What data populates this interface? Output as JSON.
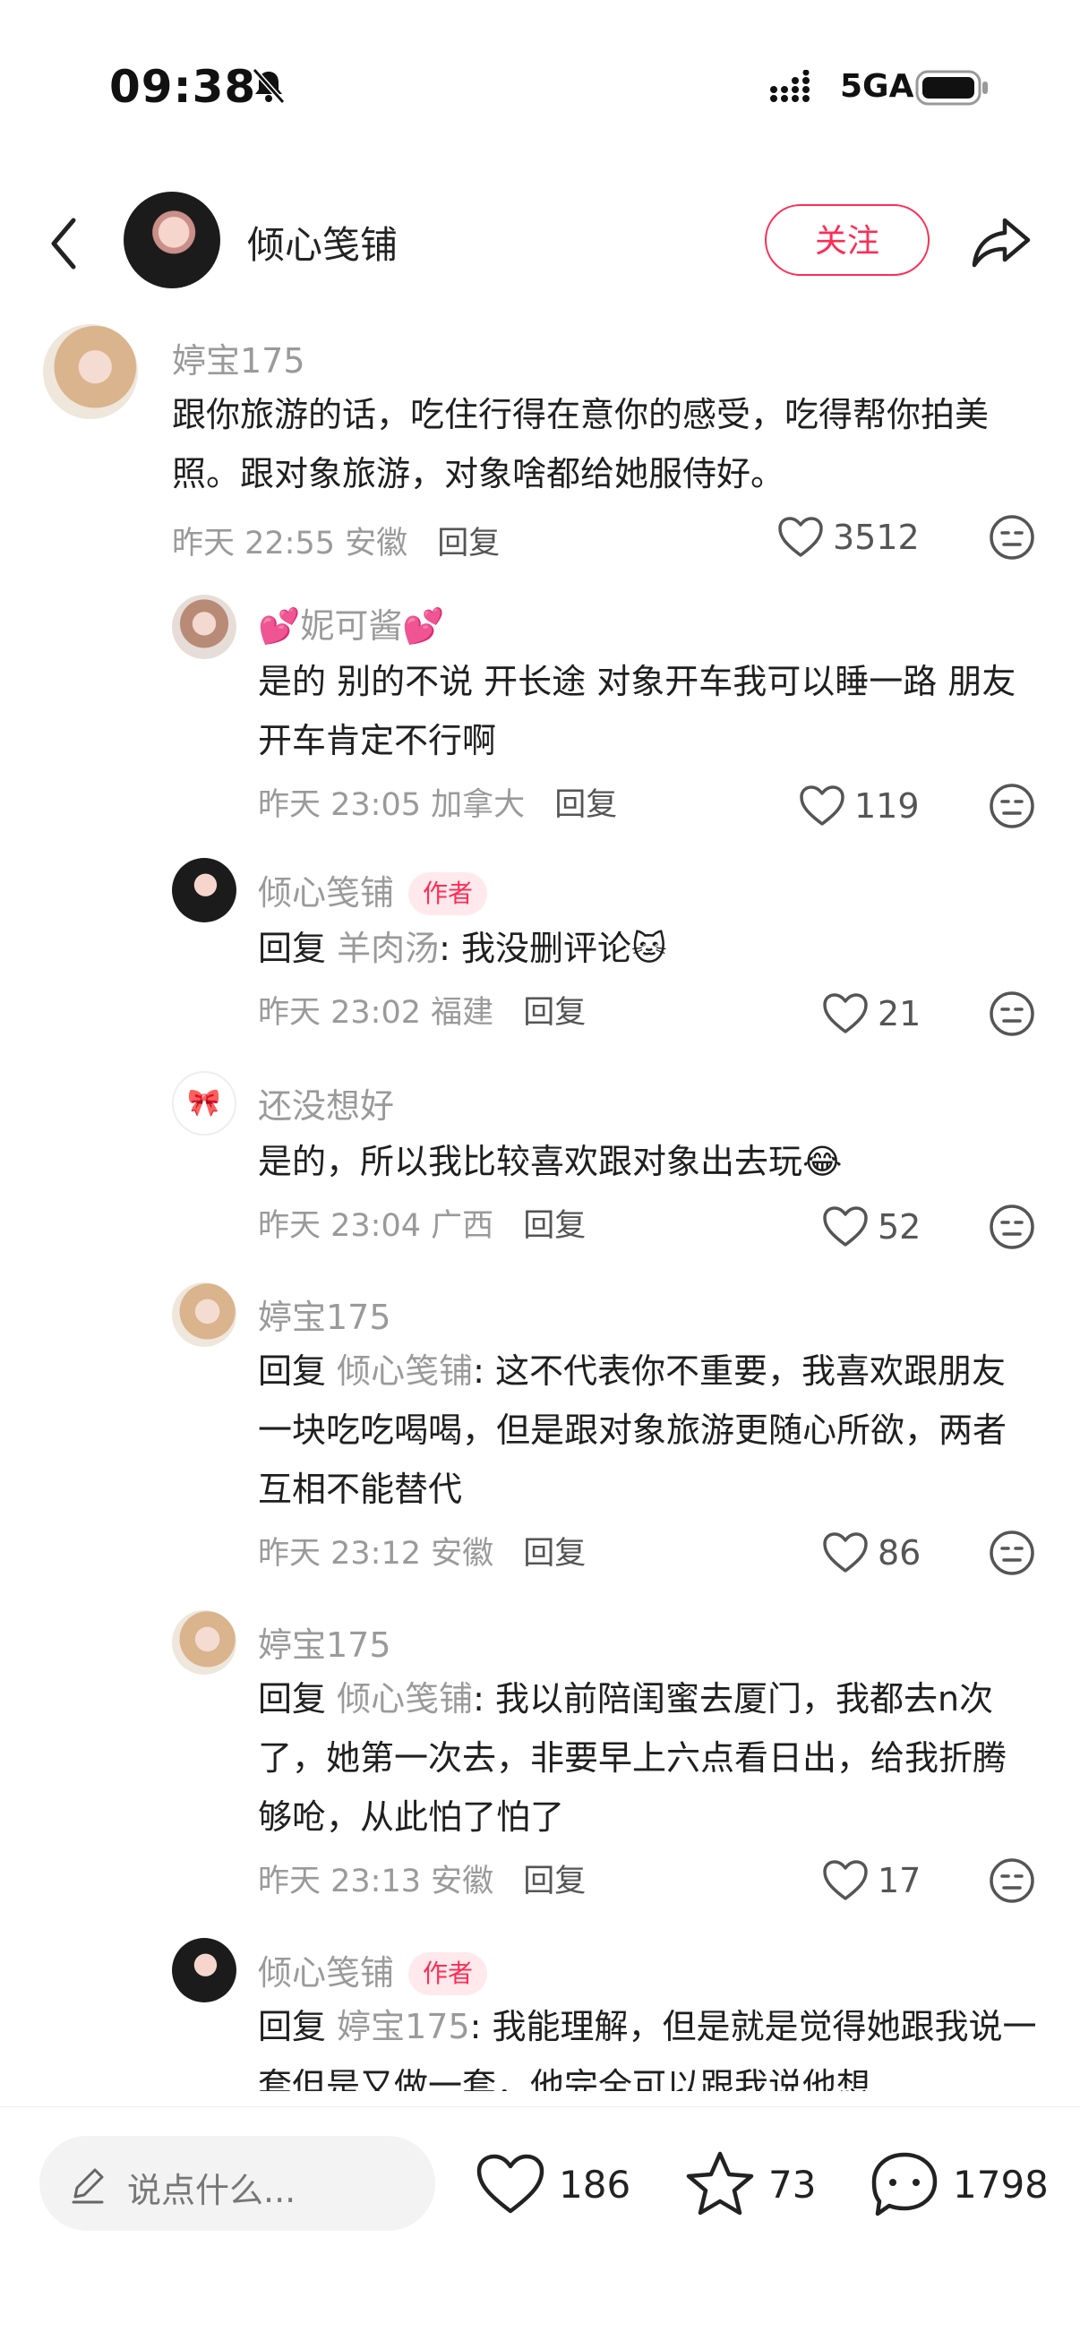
{
  "status_bar": {
    "time": "09:38",
    "network": "5GA"
  },
  "header": {
    "name": "倾心笺铺",
    "follow_label": "关注"
  },
  "comments": [
    {
      "name": "婷宝175",
      "text": "跟你旅游的话，吃住行得在意你的感受，吃得帮你拍美照。跟对象旅游，对象啥都给她服侍好。",
      "time": "昨天 22:55",
      "location": "安徽",
      "reply_label": "回复",
      "likes": "3512"
    },
    {
      "name": "妮可酱",
      "name_deco": "💕",
      "text": "是的 别的不说 开长途 对象开车我可以睡一路 朋友开车肯定不行啊",
      "time": "昨天 23:05",
      "location": "加拿大",
      "reply_label": "回复",
      "likes": "119"
    },
    {
      "name": "倾心笺铺",
      "badge": "作者",
      "reply_prefix": "回复",
      "mention": "羊肉汤",
      "text": ": 我没删评论🐱",
      "time": "昨天 23:02",
      "location": "福建",
      "reply_label": "回复",
      "likes": "21"
    },
    {
      "name": "还没想好",
      "avatar_glyph": "🎀",
      "text": "是的，所以我比较喜欢跟对象出去玩😂",
      "time": "昨天 23:04",
      "location": "广西",
      "reply_label": "回复",
      "likes": "52"
    },
    {
      "name": "婷宝175",
      "reply_prefix": "回复",
      "mention": "倾心笺铺",
      "text": ": 这不代表你不重要，我喜欢跟朋友一块吃吃喝喝，但是跟对象旅游更随心所欲，两者互相不能替代",
      "time": "昨天 23:12",
      "location": "安徽",
      "reply_label": "回复",
      "likes": "86"
    },
    {
      "name": "婷宝175",
      "reply_prefix": "回复",
      "mention": "倾心笺铺",
      "text": ": 我以前陪闺蜜去厦门，我都去n次了，她第一次去，非要早上六点看日出，给我折腾够呛，从此怕了怕了",
      "time": "昨天 23:13",
      "location": "安徽",
      "reply_label": "回复",
      "likes": "17"
    },
    {
      "name": "倾心笺铺",
      "badge": "作者",
      "reply_prefix": "回复",
      "mention": "婷宝175",
      "text": ": 我能理解，但是就是觉得她跟我说一套但是又做一套，他完全可以跟我说他想",
      "time": "",
      "location": "",
      "reply_label": "",
      "likes": ""
    }
  ],
  "bottom_bar": {
    "placeholder": "说点什么...",
    "likes": "186",
    "stars": "73",
    "comments": "1798"
  },
  "colors": {
    "accent": "#ff2c55",
    "meta": "#9a9a9a"
  }
}
